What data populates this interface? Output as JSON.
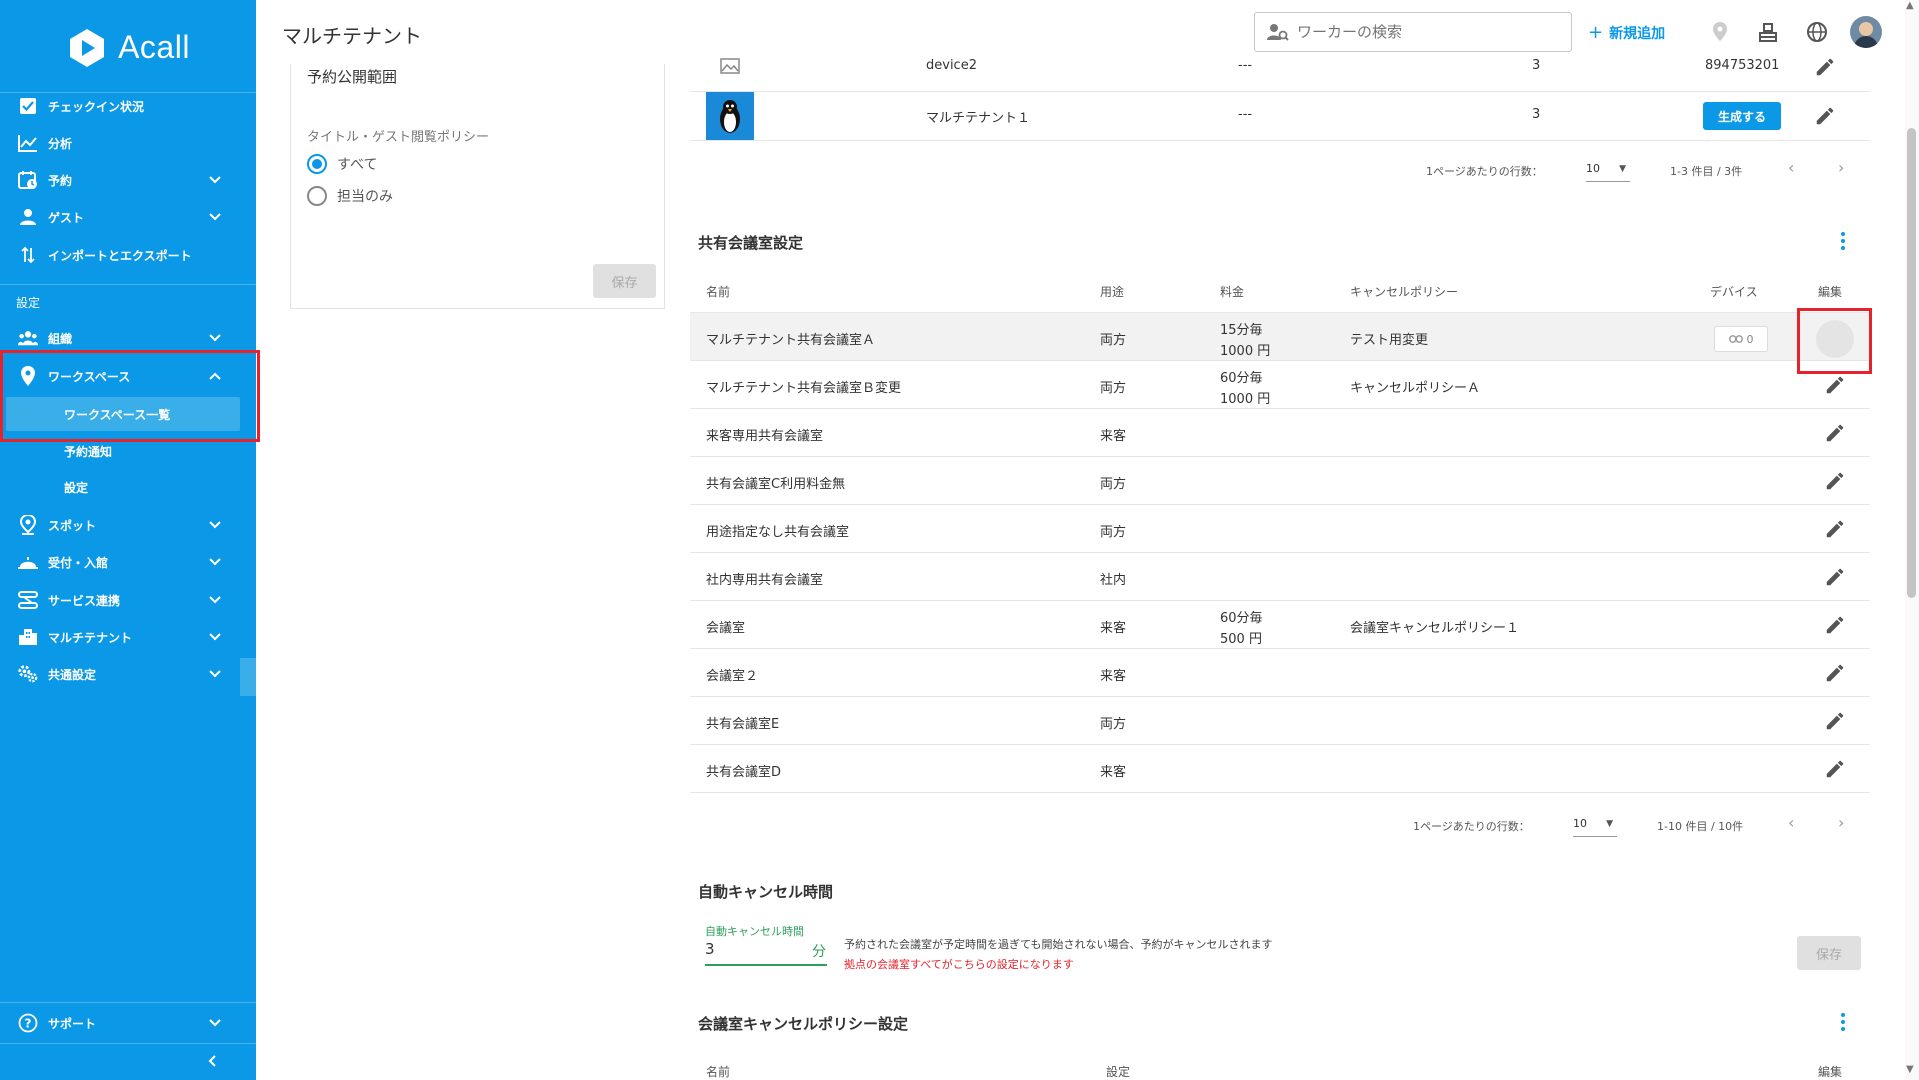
{
  "app": {
    "logo_text": "Acall"
  },
  "sidebar": {
    "items": [
      {
        "label": "チェックイン状況",
        "icon": "checkbox-icon"
      },
      {
        "label": "分析",
        "icon": "chart-line-icon"
      },
      {
        "label": "予約",
        "icon": "calendar-icon",
        "expandable": true
      },
      {
        "label": "ゲスト",
        "icon": "guest-icon",
        "expandable": true
      },
      {
        "label": "インポートとエクスポート",
        "icon": "import-export-icon"
      }
    ],
    "section_label": "設定",
    "settings_items": [
      {
        "label": "組織",
        "icon": "people-icon",
        "expandable": true
      },
      {
        "label": "ワークスペース",
        "icon": "location-pin-icon",
        "expanded": true
      },
      {
        "label": "スポット",
        "icon": "spot-pin-icon",
        "expandable": true
      },
      {
        "label": "受付・入館",
        "icon": "reception-icon",
        "expandable": true
      },
      {
        "label": "サービス連携",
        "icon": "service-link-icon",
        "expandable": true
      },
      {
        "label": "マルチテナント",
        "icon": "building-icon",
        "expandable": true
      },
      {
        "label": "共通設定",
        "icon": "gears-icon",
        "expandable": true
      }
    ],
    "workspace_sub": [
      "ワークスペース一覧",
      "予約通知",
      "設定"
    ],
    "support_label": "サポート"
  },
  "header": {
    "title": "マルチテナント",
    "search_placeholder": "ワーカーの検索",
    "add_new_label": "新規追加"
  },
  "left_card": {
    "title": "予約公開範囲",
    "policy_label": "タイトル・ゲスト閲覧ポリシー",
    "options": [
      "すべて",
      "担当のみ"
    ],
    "selected_index": 0,
    "save_label": "保存"
  },
  "tenant_table": {
    "rows": [
      {
        "name": "device2",
        "col2": "---",
        "col3": "3",
        "col4": "894753201"
      },
      {
        "name": "マルチテナント１",
        "col2": "---",
        "col3": "3",
        "action": "生成する"
      }
    ],
    "rows_per_page_label": "1ページあたりの行数：",
    "rows_per_page": "10",
    "range": "1-3 件目 / 3件"
  },
  "shared_rooms": {
    "title": "共有会議室設定",
    "headers": {
      "name": "名前",
      "usage": "用途",
      "fee": "料金",
      "cancel": "キャンセルポリシー",
      "device": "デバイス",
      "edit": "編集"
    },
    "rows": [
      {
        "name": "マルチテナント共有会議室Ａ",
        "usage": "両方",
        "fee1": "15分毎",
        "fee2": "1000 円",
        "cancel": "テスト用変更",
        "device": "0"
      },
      {
        "name": "マルチテナント共有会議室Ｂ変更",
        "usage": "両方",
        "fee1": "60分毎",
        "fee2": "1000 円",
        "cancel": "キャンセルポリシーＡ",
        "device": ""
      },
      {
        "name": "来客専用共有会議室",
        "usage": "来客",
        "fee1": "",
        "fee2": "",
        "cancel": "",
        "device": ""
      },
      {
        "name": "共有会議室C利用料金無",
        "usage": "両方",
        "fee1": "",
        "fee2": "",
        "cancel": "",
        "device": ""
      },
      {
        "name": "用途指定なし共有会議室",
        "usage": "両方",
        "fee1": "",
        "fee2": "",
        "cancel": "",
        "device": ""
      },
      {
        "name": "社内専用共有会議室",
        "usage": "社内",
        "fee1": "",
        "fee2": "",
        "cancel": "",
        "device": ""
      },
      {
        "name": "会議室",
        "usage": "来客",
        "fee1": "60分毎",
        "fee2": "500 円",
        "cancel": "会議室キャンセルポリシー１",
        "device": ""
      },
      {
        "name": "会議室２",
        "usage": "来客",
        "fee1": "",
        "fee2": "",
        "cancel": "",
        "device": ""
      },
      {
        "name": "共有会議室E",
        "usage": "両方",
        "fee1": "",
        "fee2": "",
        "cancel": "",
        "device": ""
      },
      {
        "name": "共有会議室D",
        "usage": "来客",
        "fee1": "",
        "fee2": "",
        "cancel": "",
        "device": ""
      }
    ],
    "rows_per_page_label": "1ページあたりの行数：",
    "rows_per_page": "10",
    "range": "1-10 件目 / 10件"
  },
  "auto_cancel": {
    "title": "自動キャンセル時間",
    "field_label": "自動キャンセル時間",
    "value": "3",
    "unit": "分",
    "description": "予約された会議室が予定時間を過ぎても開始されない場合、予約がキャンセルされます",
    "warning": "拠点の会議室すべてがこちらの設定になります",
    "save_label": "保存"
  },
  "cancel_policy": {
    "title": "会議室キャンセルポリシー設定",
    "headers": {
      "name": "名前",
      "setting": "設定",
      "edit": "編集"
    }
  },
  "colors": {
    "brand": "#0b98e6",
    "highlight": "#e5232d",
    "accent_green": "#2e9e5b"
  }
}
